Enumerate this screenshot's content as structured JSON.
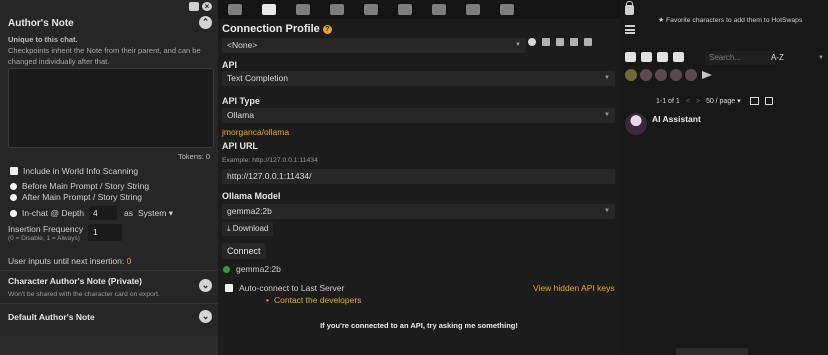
{
  "authors_note": {
    "title": "Author's Note",
    "unique_label": "Unique to this chat.",
    "checkpoints_desc": "Checkpoints inherit the Note from their parent, and can be changed individually after that.",
    "textarea_value": "",
    "tokens_label": "Tokens: 0",
    "include_wi_label": "Include in World Info Scanning",
    "include_wi_checked": false,
    "positions": [
      {
        "label": "Before Main Prompt / Story String",
        "checked": false
      },
      {
        "label": "After Main Prompt / Story String",
        "checked": false
      }
    ],
    "in_chat_label": "In-chat @ Depth",
    "depth_value": "4",
    "as_label": "as",
    "role_value": "System",
    "insertion_freq_label": "Insertion Frequency",
    "insertion_freq_note": "(0 = Disable, 1 = Always)",
    "insertion_freq_value": "1",
    "user_inputs_label": "User inputs until next insertion:",
    "user_inputs_value": "0",
    "char_note_title": "Character Author's Note (Private)",
    "char_note_desc": "Won't be shared with the character card on export.",
    "default_note_title": "Default Author's Note"
  },
  "connection": {
    "title": "Connection Profile",
    "help_glyph": "?",
    "profile_value": "<None>",
    "api_label": "API",
    "api_value": "Text Completion",
    "api_type_label": "API Type",
    "api_type_value": "Ollama",
    "repo_link": "jmorganca/ollama",
    "api_url_label": "API URL",
    "api_url_example": "Example: http://127.0.0.1:11434",
    "api_url_value": "http://127.0.0.1:11434/",
    "model_label": "Ollama Model",
    "model_value": "gemma2:2b",
    "download_label": "Download",
    "connect_label": "Connect",
    "status_text": "gemma2:2b",
    "status_color": "#2e9a3a",
    "auto_connect_label": "Auto-connect to Last Server",
    "auto_connect_checked": false,
    "hidden_keys_label": "View hidden API keys",
    "contact_label": "Contact the developers",
    "ask_text": "If you're connected to an API, try asking me something!"
  },
  "characters": {
    "fav_hint": "Favorite characters to add them to HotSwaps",
    "search_placeholder": "Search...",
    "sort_value": "A-Z",
    "pager_range": "1-1 of 1",
    "pager_prev": "<",
    "pager_next": ">",
    "per_page": "50 / page",
    "items": [
      {
        "name": "AI Assistant"
      }
    ]
  },
  "colors": {
    "accent": "#e8a820",
    "bg": "#1c1c1c",
    "panel": "#262626"
  }
}
